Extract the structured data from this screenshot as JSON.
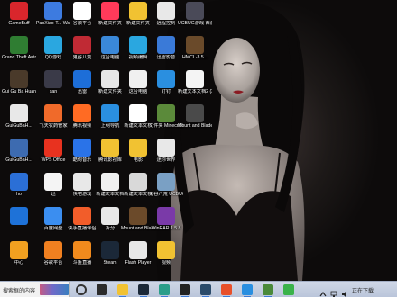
{
  "desktop": {
    "icons": [
      {
        "label": "GameBuff",
        "icon": "gamebuff-icon",
        "color": "#d9262c"
      },
      {
        "label": "Grand Theft Auto V v1...",
        "icon": "gta-icon",
        "color": "#2f7d32"
      },
      {
        "label": "Gui Gu Ba Huang Ear...",
        "icon": "game-icon",
        "color": "#4a3a2a"
      },
      {
        "label": "GuiGuBaH...",
        "icon": "doc-icon",
        "color": "#e8e8e8"
      },
      {
        "label": "GuiGuBaH...",
        "icon": "game-icon",
        "color": "#3d6bb0"
      },
      {
        "label": "ho",
        "icon": "app-icon",
        "color": "#2b6fd6"
      },
      {
        "label": "",
        "icon": "app-icon",
        "color": "#1e72d8"
      },
      {
        "label": "中心",
        "icon": "app-icon",
        "color": "#f0a020"
      },
      {
        "label": "PaoXiao-T... War THRE...",
        "icon": "game-icon",
        "color": "#3d7be0"
      },
      {
        "label": "QQ游戏",
        "icon": "qq-game-icon",
        "color": "#2aa7e0"
      },
      {
        "label": "san",
        "icon": "folder-icon",
        "color": "#3a3a48"
      },
      {
        "label": "飞天农药管家",
        "icon": "app-icon",
        "color": "#f06a2a"
      },
      {
        "label": "WPS Office",
        "icon": "wps-icon",
        "color": "#e8321f"
      },
      {
        "label": "迅",
        "icon": "app-icon",
        "color": "#f4f4f4"
      },
      {
        "label": "百度网盘",
        "icon": "baidu-netdisk-icon",
        "color": "#3b8ef0"
      },
      {
        "label": "谷歌平台",
        "icon": "app-icon",
        "color": "#f08020"
      },
      {
        "label": "谷歌平台",
        "icon": "app-icon",
        "color": "#fff"
      },
      {
        "label": "鬼谷八荒",
        "icon": "game-icon",
        "color": "#c02a34"
      },
      {
        "label": "迅雷",
        "icon": "thunder-icon",
        "color": "#1d6ed8"
      },
      {
        "label": "腾讯视频",
        "icon": "video-icon",
        "color": "#ff6b23"
      },
      {
        "label": "酷狗音乐",
        "icon": "music-icon",
        "color": "#2a73e8"
      },
      {
        "label": "快吧游戏",
        "icon": "app-icon",
        "color": "#e8e8e8"
      },
      {
        "label": "快手直播伴侣",
        "icon": "app-icon",
        "color": "#f25d2a"
      },
      {
        "label": "斗鱼直播",
        "icon": "app-icon",
        "color": "#f08a1d"
      },
      {
        "label": "新建文件夹",
        "icon": "app-icon",
        "color": "#ff3a5a"
      },
      {
        "label": "这台电脑",
        "icon": "computer-icon",
        "color": "#3a88d8"
      },
      {
        "label": "新建文件夹",
        "icon": "doc-icon",
        "color": "#e7e7e7"
      },
      {
        "label": "上网导航",
        "icon": "browser-icon",
        "color": "#2a8fe0"
      },
      {
        "label": "腾讯影视库",
        "icon": "folder-icon",
        "color": "#f1c232"
      },
      {
        "label": "新建文本文档",
        "icon": "doc-icon",
        "color": "#f0f0f0"
      },
      {
        "label": "拆分",
        "icon": "doc-icon",
        "color": "#e8e8e8"
      },
      {
        "label": "Steam",
        "icon": "steam-icon",
        "color": "#1b2838"
      },
      {
        "label": "新建文件夹",
        "icon": "folder-icon",
        "color": "#f1c232"
      },
      {
        "label": "视频编辑",
        "icon": "app-icon",
        "color": "#2aa7e0"
      },
      {
        "label": "这台电脑",
        "icon": "computer-icon",
        "color": "#f0f0f0"
      },
      {
        "label": "新建文本文档",
        "icon": "doc-icon",
        "color": "#fff"
      },
      {
        "label": "电影",
        "icon": "folder-icon",
        "color": "#f1c232"
      },
      {
        "label": "新建文本文档",
        "icon": "doc-icon",
        "color": "#d9d9d9"
      },
      {
        "label": "Mount and Blade II B...",
        "icon": "game-icon",
        "color": "#6b4a2a"
      },
      {
        "label": "Flash Player",
        "icon": "flash-icon",
        "color": "#e8e8e8"
      },
      {
        "label": "远程控制",
        "icon": "app-icon",
        "color": "#e8e8e8"
      },
      {
        "label": "迅雷影音",
        "icon": "app-icon",
        "color": "#3a7ad8"
      },
      {
        "label": "钉钉",
        "icon": "app-icon",
        "color": "#2a8fe0"
      },
      {
        "label": "文件夹 Minecraft",
        "icon": "minecraft-icon",
        "color": "#5b8a3a"
      },
      {
        "label": "迷你世界",
        "icon": "app-icon",
        "color": "#e8e8e8"
      },
      {
        "label": "鬼谷八荒 UCBUG游...",
        "icon": "game-icon",
        "color": "#7aa0c4"
      },
      {
        "label": "WinRAR 1.5.8",
        "icon": "winrar-icon",
        "color": "#7a3aa8"
      },
      {
        "label": "视频",
        "icon": "folder-icon",
        "color": "#f1c232"
      },
      {
        "label": "UCBUG游戏 西游仙侠",
        "icon": "game-icon",
        "color": "#4a4a58"
      },
      {
        "label": "HMCL-3.5...",
        "icon": "hmcl-icon",
        "color": "#6a4a2a"
      },
      {
        "label": "新建文本文档2 (3)",
        "icon": "doc-icon",
        "color": "#f4f4f4"
      },
      {
        "label": "Mount and Blade II B...",
        "icon": "game-icon",
        "color": "#4a4a4a"
      }
    ]
  },
  "taskbar": {
    "search_placeholder": "搜索框的内容",
    "tray_status": "正在下载",
    "apps": [
      {
        "icon": "cortana-icon",
        "color": "#ffffff"
      },
      {
        "icon": "task-view-icon",
        "color": "#2b2b2b"
      },
      {
        "icon": "explorer-icon",
        "color": "#f1c232"
      },
      {
        "icon": "steam-icon",
        "color": "#1b2838"
      },
      {
        "icon": "edge-icon",
        "color": "#2a9e8a"
      },
      {
        "icon": "capcut-icon",
        "color": "#222222"
      },
      {
        "icon": "steam-icon",
        "color": "#2a4a6a"
      },
      {
        "icon": "browser-icon",
        "color": "#e8502a"
      },
      {
        "icon": "qq-icon",
        "color": "#2a8fe0"
      },
      {
        "icon": "app-icon",
        "color": "#4a8a3a"
      },
      {
        "icon": "wechat-icon",
        "color": "#3ab34a"
      }
    ]
  }
}
